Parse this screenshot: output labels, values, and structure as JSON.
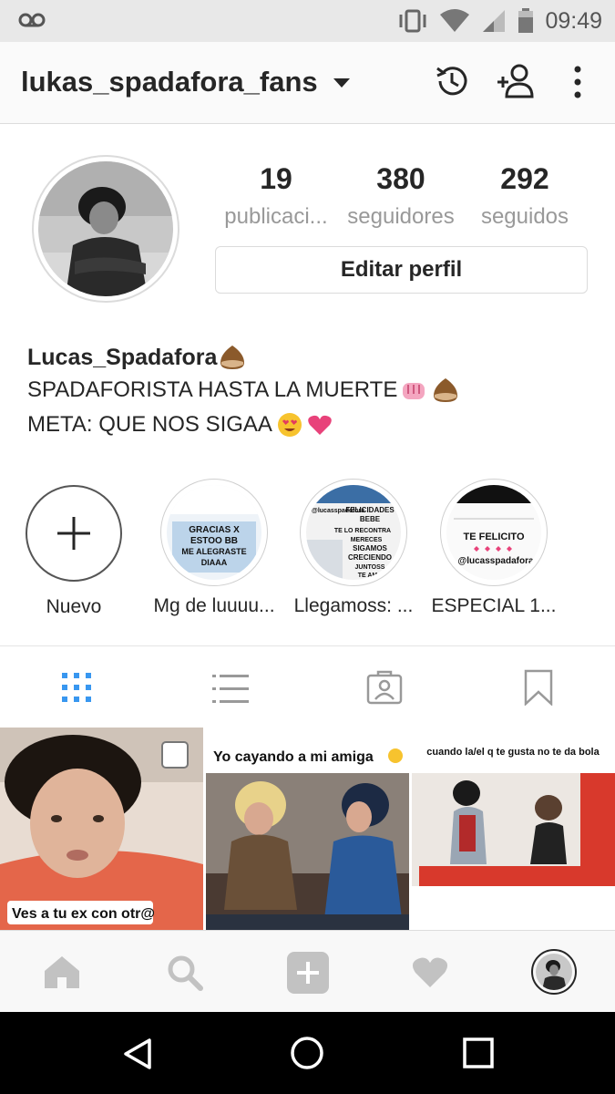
{
  "status_bar": {
    "time": "09:49",
    "icons": [
      "voicemail-icon",
      "vibrate-icon",
      "wifi-icon",
      "signal-icon",
      "battery-icon"
    ]
  },
  "header": {
    "username": "lukas_spadafora_fans",
    "icons": [
      "chevron-down-icon",
      "history-icon",
      "add-person-icon",
      "more-icon"
    ]
  },
  "profile": {
    "stats": [
      {
        "value": "19",
        "label": "publicaci..."
      },
      {
        "value": "380",
        "label": "seguidores"
      },
      {
        "value": "292",
        "label": "seguidos"
      }
    ],
    "edit_button": "Editar perfil",
    "display_name": "Lucas_Spadafora",
    "bio_line_1": "SPADAFORISTA HASTA LA MUERTE",
    "bio_line_2": "META: QUE NOS SIGAA"
  },
  "highlights": [
    {
      "label": "Nuevo",
      "thumb_texts": []
    },
    {
      "label": "Mg de luuuu...",
      "thumb_texts": [
        "GRACIAS X",
        "ESTOO BB",
        "ME ALEGRASTE",
        "DIAAA"
      ]
    },
    {
      "label": "Llegamoss: ...",
      "thumb_texts": [
        "@lucasspadafora",
        "FELICIDADES",
        "BEBE",
        "TE LO RECONTRA",
        "MERECES",
        "SIGAMOS",
        "CRECIENDO",
        "JUNTOSS",
        "TE AMA"
      ]
    },
    {
      "label": "ESPECIAL 1...",
      "thumb_texts": [
        "TE FELICITO",
        "@lucasspadafora"
      ]
    }
  ],
  "tabs": [
    "grid-icon",
    "list-icon",
    "tagged-icon",
    "bookmark-icon"
  ],
  "posts": [
    {
      "caption": "Ves a tu ex con otr@"
    },
    {
      "caption": "Yo cayando a mi amiga"
    },
    {
      "caption": "cuando la/el q te gusta no te da bola"
    }
  ],
  "bottom_nav": [
    "home-icon",
    "search-icon",
    "add-icon",
    "heart-icon",
    "profile-avatar"
  ],
  "colors": {
    "accent": "#3897f0",
    "heart": "#e8427a",
    "chestnut": "#8b5a2b"
  }
}
